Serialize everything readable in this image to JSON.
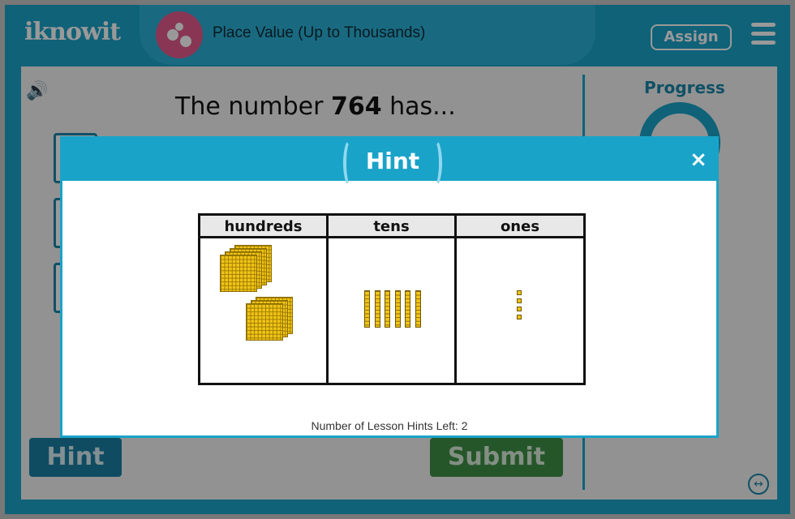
{
  "header": {
    "logo_text": "iknowit",
    "topic_title": "Place Value (Up to Thousands)",
    "assign_label": "Assign"
  },
  "question": {
    "prefix": "The number ",
    "number": "764",
    "suffix": " has..."
  },
  "sidebar": {
    "progress_label": "Progress"
  },
  "buttons": {
    "hint_label": "Hint",
    "submit_label": "Submit"
  },
  "modal": {
    "title": "Hint",
    "close_symbol": "×",
    "columns": [
      "hundreds",
      "tens",
      "ones"
    ],
    "blocks": {
      "hundreds": 7,
      "tens": 6,
      "ones": 4
    },
    "hints_left_text": "Number of Lesson Hints Left: 2"
  },
  "colors": {
    "brand_blue": "#1aa3c9",
    "submit_green": "#3f8f47",
    "block_yellow": "#f2c418"
  },
  "icons": [
    "sound-icon",
    "menu-icon",
    "close-icon",
    "expand-icon",
    "topic-icon"
  ]
}
